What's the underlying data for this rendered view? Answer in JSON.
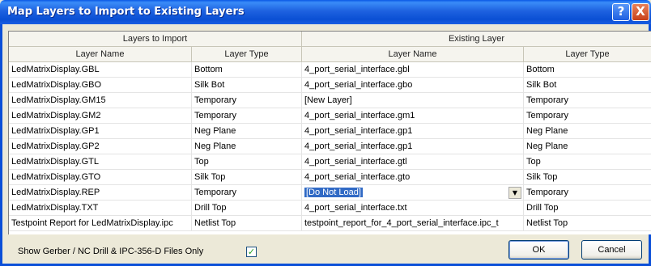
{
  "window": {
    "title": "Map Layers to Import to Existing Layers",
    "help_glyph": "?",
    "close_glyph": "X"
  },
  "table": {
    "group_headers": [
      "Layers to Import",
      "Existing Layer"
    ],
    "column_headers": [
      "Layer Name",
      "Layer Type",
      "Layer Name",
      "Layer Type"
    ],
    "rows": [
      [
        "LedMatrixDisplay.GBL",
        "Bottom",
        "4_port_serial_interface.gbl",
        "Bottom"
      ],
      [
        "LedMatrixDisplay.GBO",
        "Silk Bot",
        "4_port_serial_interface.gbo",
        "Silk Bot"
      ],
      [
        "LedMatrixDisplay.GM15",
        "Temporary",
        "[New Layer]",
        "Temporary"
      ],
      [
        "LedMatrixDisplay.GM2",
        "Temporary",
        "4_port_serial_interface.gm1",
        "Temporary"
      ],
      [
        "LedMatrixDisplay.GP1",
        "Neg Plane",
        "4_port_serial_interface.gp1",
        "Neg Plane"
      ],
      [
        "LedMatrixDisplay.GP2",
        "Neg Plane",
        "4_port_serial_interface.gp1",
        "Neg Plane"
      ],
      [
        "LedMatrixDisplay.GTL",
        "Top",
        "4_port_serial_interface.gtl",
        "Top"
      ],
      [
        "LedMatrixDisplay.GTO",
        "Silk Top",
        "4_port_serial_interface.gto",
        "Silk Top"
      ],
      [
        "LedMatrixDisplay.REP",
        "Temporary",
        "[Do Not Load]",
        "Temporary"
      ],
      [
        "LedMatrixDisplay.TXT",
        "Drill Top",
        "4_port_serial_interface.txt",
        "Drill Top"
      ],
      [
        "Testpoint Report for LedMatrixDisplay.ipc",
        "Netlist Top",
        "testpoint_report_for_4_port_serial_interface.ipc_t",
        "Netlist Top"
      ]
    ],
    "editing_row_index": 8
  },
  "footer": {
    "filter_label": "Show Gerber / NC Drill & IPC-356-D Files Only",
    "filter_checked": true,
    "check_glyph": "✓",
    "ok_label": "OK",
    "cancel_label": "Cancel"
  }
}
